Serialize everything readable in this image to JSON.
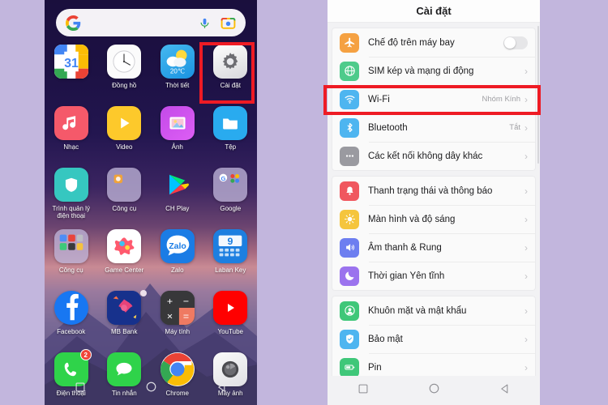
{
  "background_color": "#c2b6dd",
  "accent_highlight_color": "#ee1b24",
  "left_phone": {
    "name": "android-home-screen",
    "search": {
      "placeholder": "",
      "value": "",
      "icons": [
        "google-g-icon",
        "microphone-icon",
        "google-lens-icon"
      ]
    },
    "apps": [
      {
        "label": "",
        "icon": "calendar-icon",
        "day": "31",
        "badge": ""
      },
      {
        "label": "Đồng hồ",
        "icon": "clock-icon",
        "badge": ""
      },
      {
        "label": "Thời tiết",
        "icon": "weather-icon",
        "temp": "20℃",
        "badge": ""
      },
      {
        "label": "Cài đặt",
        "icon": "gear-icon",
        "badge": ""
      },
      {
        "label": "Nhạc",
        "icon": "music-note-icon",
        "badge": ""
      },
      {
        "label": "Video",
        "icon": "play-triangle-icon",
        "badge": ""
      },
      {
        "label": "Ảnh",
        "icon": "photo-icon",
        "badge": ""
      },
      {
        "label": "Tệp",
        "icon": "folder-icon",
        "badge": ""
      },
      {
        "label": "Trình quản lý điện thoại",
        "icon": "shield-icon",
        "badge": ""
      },
      {
        "label": "Công cụ",
        "icon": "tools-folder-icon",
        "badge": ""
      },
      {
        "label": "CH Play",
        "icon": "play-store-icon",
        "badge": ""
      },
      {
        "label": "Google",
        "icon": "google-folder-icon",
        "badge": ""
      },
      {
        "label": "Công cụ",
        "icon": "utilities-folder-icon",
        "badge": ""
      },
      {
        "label": "Game Center",
        "icon": "game-center-icon",
        "badge": ""
      },
      {
        "label": "Zalo",
        "icon": "zalo-icon",
        "badge": ""
      },
      {
        "label": "Laban Key",
        "icon": "laban-key-icon",
        "badge": ""
      },
      {
        "label": "Facebook",
        "icon": "facebook-icon",
        "badge": ""
      },
      {
        "label": "MB Bank",
        "icon": "mb-bank-icon",
        "badge": ""
      },
      {
        "label": "Máy tính",
        "icon": "calculator-icon",
        "badge": ""
      },
      {
        "label": "YouTube",
        "icon": "youtube-icon",
        "badge": ""
      },
      {
        "label": "Điện thoại",
        "icon": "phone-icon",
        "badge": "2"
      },
      {
        "label": "Tin nhắn",
        "icon": "messages-icon",
        "badge": ""
      },
      {
        "label": "Chrome",
        "icon": "chrome-icon",
        "badge": ""
      },
      {
        "label": "Máy ảnh",
        "icon": "camera-icon",
        "badge": ""
      }
    ],
    "navbar": [
      "recents-square-icon",
      "home-circle-icon",
      "back-triangle-icon"
    ]
  },
  "right_phone": {
    "name": "android-settings-screen",
    "header_title": "Cài đặt",
    "groups": [
      {
        "rows": [
          {
            "label": "Chế độ trên máy bay",
            "icon": "airplane-icon",
            "icon_color": "#f39game",
            "value": "",
            "control": "toggle",
            "toggle_on": false
          },
          {
            "label": "SIM kép và mạng di động",
            "icon": "globe-icon",
            "value": "",
            "control": "chevron"
          },
          {
            "label": "Wi-Fi",
            "icon": "wifi-icon",
            "value": "Nhóm Kính",
            "control": "chevron",
            "highlighted": true
          },
          {
            "label": "Bluetooth",
            "icon": "bluetooth-icon",
            "value": "Tắt",
            "control": "chevron"
          },
          {
            "label": "Các kết nối không dây khác",
            "icon": "more-dots-icon",
            "value": "",
            "control": "chevron"
          }
        ]
      },
      {
        "rows": [
          {
            "label": "Thanh trạng thái và thông báo",
            "icon": "notification-bell-icon",
            "value": "",
            "control": "chevron"
          },
          {
            "label": "Màn hình và độ sáng",
            "icon": "brightness-icon",
            "value": "",
            "control": "chevron"
          },
          {
            "label": "Âm thanh & Rung",
            "icon": "speaker-icon",
            "value": "",
            "control": "chevron"
          },
          {
            "label": "Thời gian Yên tĩnh",
            "icon": "moon-icon",
            "value": "",
            "control": "chevron"
          }
        ]
      },
      {
        "rows": [
          {
            "label": "Khuôn mặt và mật khẩu",
            "icon": "face-id-icon",
            "value": "",
            "control": "chevron"
          },
          {
            "label": "Bảo mật",
            "icon": "security-shield-icon",
            "value": "",
            "control": "chevron"
          },
          {
            "label": "Pin",
            "icon": "battery-icon",
            "value": "",
            "control": "chevron"
          }
        ]
      }
    ],
    "navbar": [
      "recents-square-icon",
      "home-circle-icon",
      "back-triangle-icon"
    ]
  }
}
